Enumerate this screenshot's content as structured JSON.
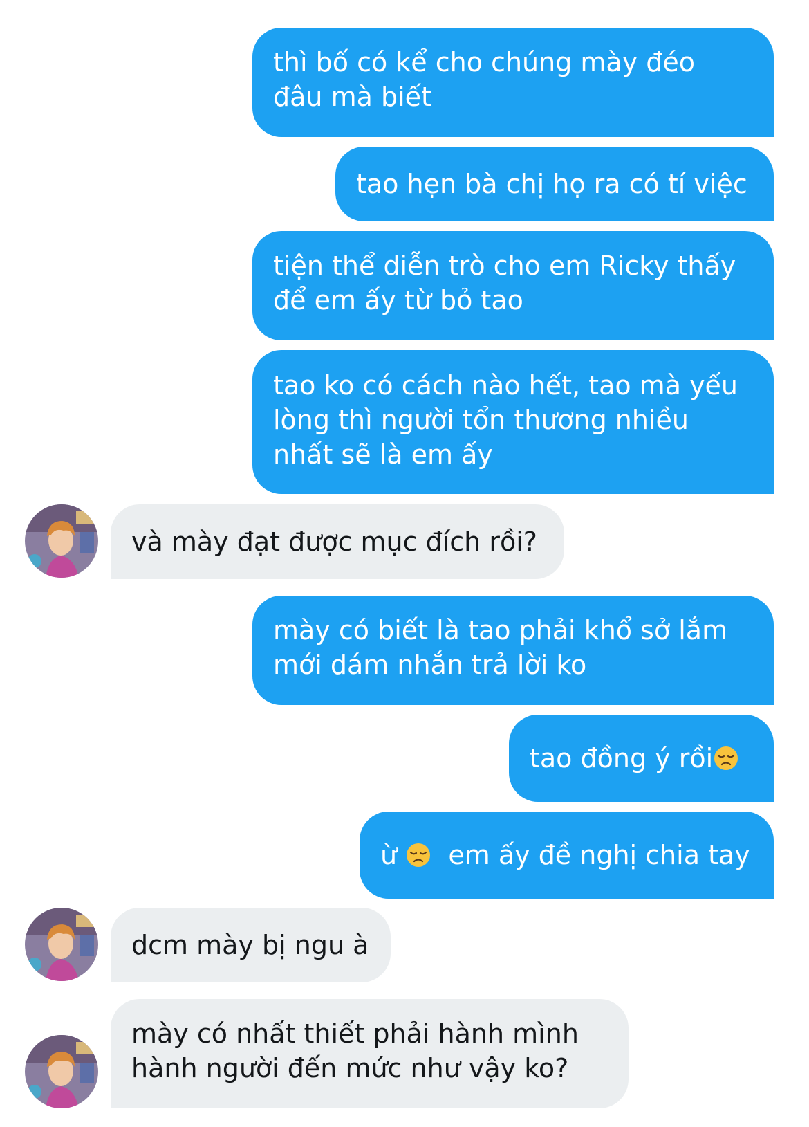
{
  "messages": [
    {
      "from": "me",
      "lines": [
        "thì bố có kể cho chúng mày đéo",
        "đâu mà biết"
      ]
    },
    {
      "from": "me",
      "lines": [
        "tao hẹn bà chị họ ra có tí việc"
      ]
    },
    {
      "from": "me",
      "lines": [
        "tiện thể diễn trò cho em Ricky thấy",
        "để em ấy từ bỏ tao"
      ]
    },
    {
      "from": "me",
      "lines": [
        "tao ko có cách nào hết, tao mà yếu",
        "lòng thì người tổn thương nhiều",
        "nhất sẽ là em ấy"
      ]
    },
    {
      "from": "them",
      "lines": [
        "và mày đạt được mục đích rồi?"
      ]
    },
    {
      "from": "me",
      "lines": [
        "mày có biết là tao phải khổ sở lắm",
        "mới dám nhắn trả lời ko"
      ]
    },
    {
      "from": "me",
      "text": "tao đồng ý rồi",
      "emoji": "disappointed-face"
    },
    {
      "from": "me",
      "text_before": "ừ",
      "emoji": "disappointed-face",
      "text_after": "em ấy đề nghị chia tay"
    },
    {
      "from": "them",
      "lines": [
        "dcm mày bị ngu à"
      ]
    },
    {
      "from": "them",
      "lines": [
        "mày có nhất thiết phải hành mình",
        "hành người đến mức như vậy ko?"
      ]
    }
  ],
  "colors": {
    "outgoing_bubble": "#1da1f2",
    "incoming_bubble": "#ebeef0",
    "outgoing_text": "#ffffff",
    "incoming_text": "#14171a"
  }
}
